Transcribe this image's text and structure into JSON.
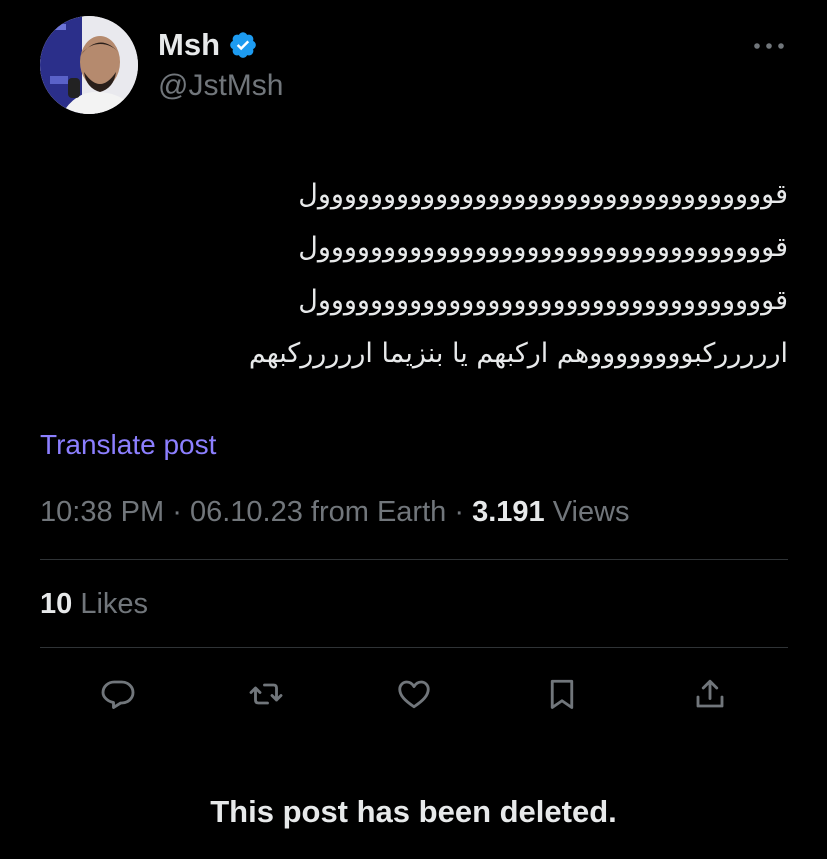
{
  "author": {
    "name": "Msh",
    "handle": "@JstMsh",
    "verified": true,
    "avatar_icon": "profile-photo",
    "verified_icon": "verified-badge-icon",
    "verified_color": "#1d9bf0"
  },
  "post": {
    "lines": [
      "قووووووووووووووووووووووووووووووووووول",
      "قووووووووووووووووووووووووووووووووووول",
      "قووووووووووووووووووووووووووووووووووول",
      "اررررركبووووووووهم اركبهم يا بنزيما اررررركبهم"
    ]
  },
  "translate_label": "Translate post",
  "meta": {
    "time": "10:38 PM",
    "separator": "·",
    "date": "06.10.23",
    "source": "from Earth",
    "views_count": "3.191",
    "views_label": "Views"
  },
  "likes": {
    "count": "10",
    "label": "Likes"
  },
  "actions": [
    {
      "name": "reply",
      "icon": "reply-icon"
    },
    {
      "name": "repost",
      "icon": "repost-icon"
    },
    {
      "name": "like",
      "icon": "heart-icon"
    },
    {
      "name": "bookmark",
      "icon": "bookmark-icon"
    },
    {
      "name": "share",
      "icon": "share-icon"
    }
  ],
  "deleted_notice": "This post has been deleted.",
  "colors": {
    "background": "#000000",
    "text_primary": "#e7e9ea",
    "text_secondary": "#71767b",
    "link": "#8c7fff",
    "divider": "#2f3336",
    "icon": "#71767b"
  }
}
